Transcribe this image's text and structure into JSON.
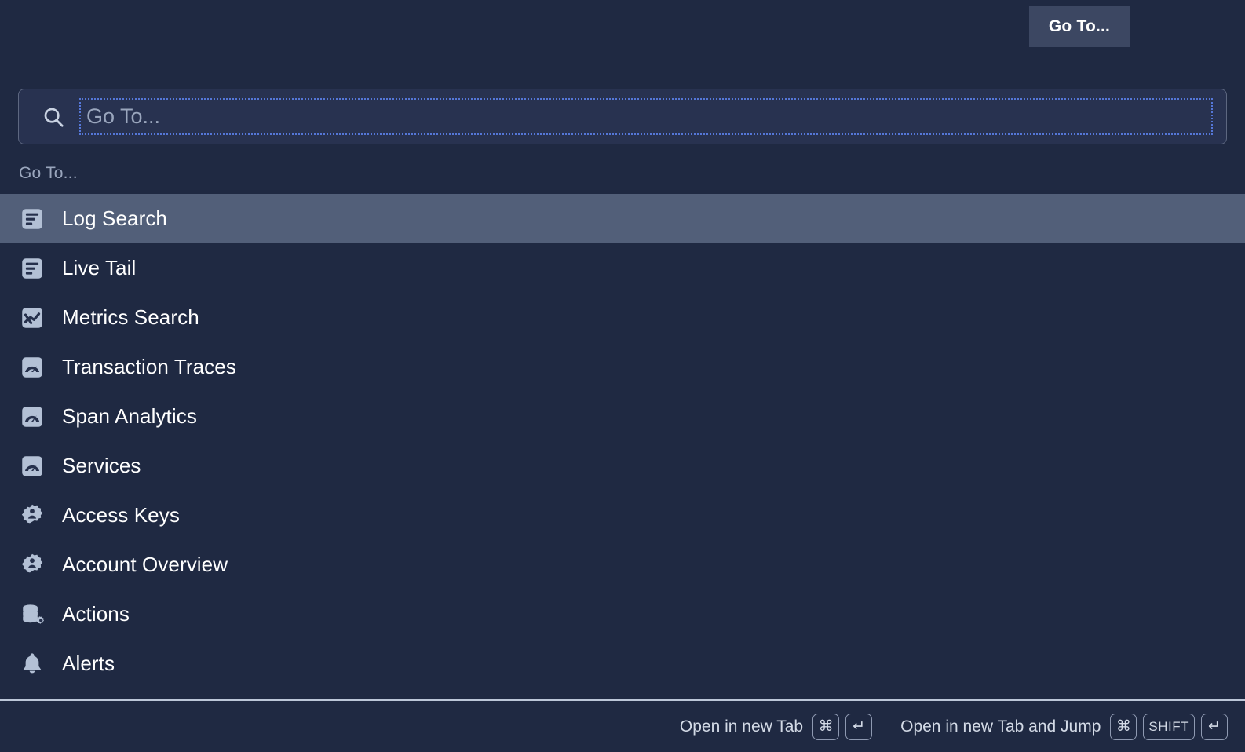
{
  "topbar": {
    "goto_button_label": "Go To..."
  },
  "search": {
    "placeholder": "Go To...",
    "value": "",
    "icon": "search-icon"
  },
  "section": {
    "label": "Go To..."
  },
  "results": {
    "items": [
      {
        "label": "Log Search",
        "icon": "log-document-icon",
        "selected": true
      },
      {
        "label": "Live Tail",
        "icon": "log-document-icon",
        "selected": false
      },
      {
        "label": "Metrics Search",
        "icon": "metrics-chart-icon",
        "selected": false
      },
      {
        "label": "Transaction Traces",
        "icon": "gauge-icon",
        "selected": false
      },
      {
        "label": "Span Analytics",
        "icon": "gauge-icon",
        "selected": false
      },
      {
        "label": "Services",
        "icon": "gauge-icon",
        "selected": false
      },
      {
        "label": "Access Keys",
        "icon": "gear-user-icon",
        "selected": false
      },
      {
        "label": "Account Overview",
        "icon": "gear-user-icon",
        "selected": false
      },
      {
        "label": "Actions",
        "icon": "database-gear-icon",
        "selected": false
      },
      {
        "label": "Alerts",
        "icon": "bell-icon",
        "selected": false
      }
    ]
  },
  "footer": {
    "hints": [
      {
        "label": "Open in new Tab",
        "keys": [
          "⌘",
          "↵"
        ]
      },
      {
        "label": "Open in new Tab and Jump",
        "keys": [
          "⌘",
          "SHIFT",
          "↵"
        ]
      }
    ]
  },
  "colors": {
    "background": "#1f2942",
    "selected_row": "#525f79",
    "button": "#3c4762",
    "search_field": "#283250",
    "focus_outline": "#5577d8",
    "icon": "#b3c0d5",
    "muted_text": "#9aa6bd",
    "divider": "#bcc6d8"
  }
}
